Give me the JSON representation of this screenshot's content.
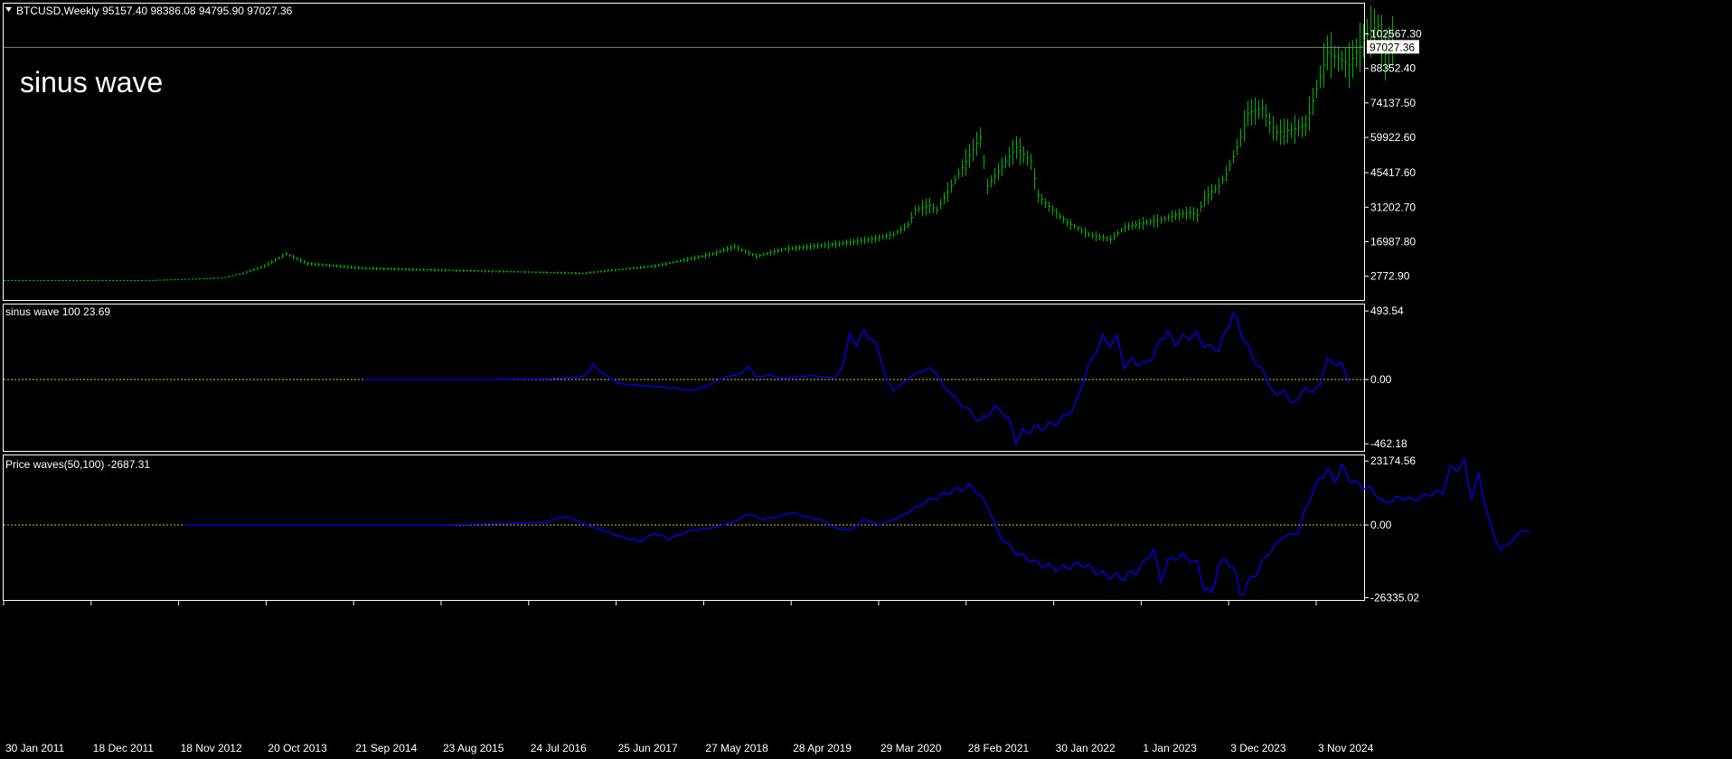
{
  "colors": {
    "background": "#000000",
    "frame": "#ffffff",
    "price_bars": "#00b000",
    "indicator_line": "#0000ff",
    "zero_line": "#d8c23a"
  },
  "main_panel": {
    "collapse_icon": "triangle-down-icon",
    "header": "BTCUSD,Weekly  95157.40 98386.08 94795.90 97027.36",
    "overlay_text": "sinus wave",
    "current_price": "97027.36"
  },
  "panel2": {
    "header": "sinus wave 100 23.69"
  },
  "panel3": {
    "header": "Price waves(50,100) -2687.31"
  },
  "chart_data": [
    {
      "type": "bar",
      "title": "BTCUSD,Weekly",
      "symbol": "BTCUSD",
      "timeframe": "Weekly",
      "ohlc_last": {
        "open": 95157.4,
        "high": 98386.08,
        "low": 94795.9,
        "close": 97027.36
      },
      "ylim": [
        -7000,
        115000
      ],
      "yticks": [
        "102567.30",
        "88352.40",
        "74137.50",
        "59922.60",
        "45417.60",
        "31202.70",
        "16987.80",
        "2772.90"
      ],
      "ytick_values": [
        102567.3,
        88352.4,
        74137.5,
        59922.6,
        45417.6,
        31202.7,
        16987.8,
        2772.9
      ],
      "xticks": [
        "30 Jan 2011",
        "18 Dec 2011",
        "18 Nov 2012",
        "20 Oct 2013",
        "21 Sep 2014",
        "23 Aug 2015",
        "24 Jul 2016",
        "25 Jun 2017",
        "27 May 2018",
        "28 Apr 2019",
        "29 Mar 2020",
        "28 Feb 2021",
        "30 Jan 2022",
        "1 Jan 2023",
        "3 Dec 2023",
        "3 Nov 2024"
      ],
      "series": [
        {
          "close_points": [
            [
              0,
              1
            ],
            [
              40,
              1
            ],
            [
              60,
              2
            ],
            [
              66,
              4
            ],
            [
              72,
              7
            ],
            [
              78,
              12
            ],
            [
              84,
              8
            ],
            [
              100,
              6
            ],
            [
              130,
              5
            ],
            [
              160,
              4
            ],
            [
              180,
              7
            ],
            [
              190,
              10
            ],
            [
              196,
              12
            ],
            [
              202,
              15
            ],
            [
              208,
              11
            ],
            [
              216,
              14
            ],
            [
              230,
              16
            ],
            [
              240,
              18
            ],
            [
              246,
              20
            ],
            [
              250,
              24
            ],
            [
              252,
              30
            ],
            [
              256,
              32
            ],
            [
              258,
              30
            ],
            [
              262,
              40
            ],
            [
              266,
              50
            ],
            [
              270,
              60
            ],
            [
              272,
              40
            ],
            [
              276,
              48
            ],
            [
              280,
              56
            ],
            [
              284,
              50
            ],
            [
              286,
              36
            ],
            [
              290,
              30
            ],
            [
              294,
              25
            ],
            [
              300,
              20
            ],
            [
              306,
              18
            ],
            [
              310,
              23
            ],
            [
              316,
              25
            ],
            [
              320,
              26
            ],
            [
              324,
              28
            ],
            [
              328,
              29
            ],
            [
              330,
              28
            ],
            [
              332,
              35
            ],
            [
              336,
              40
            ],
            [
              338,
              45
            ],
            [
              340,
              52
            ],
            [
              342,
              60
            ],
            [
              344,
              70
            ],
            [
              348,
              72
            ],
            [
              350,
              66
            ],
            [
              352,
              62
            ],
            [
              356,
              63
            ],
            [
              360,
              65
            ],
            [
              366,
              95
            ],
            [
              372,
              90
            ],
            [
              376,
              100
            ],
            [
              378,
              104
            ],
            [
              380,
              106
            ],
            [
              382,
              94
            ],
            [
              384,
              100
            ]
          ]
        }
      ]
    },
    {
      "type": "line",
      "title": "sinus wave 100 23.69",
      "name": "sinus wave",
      "period": 100,
      "last_value": 23.69,
      "ylim": [
        -520,
        540
      ],
      "yticks": [
        "493.54",
        "0.00",
        "-462.18"
      ],
      "ytick_values": [
        493.54,
        0,
        -462.18
      ],
      "zero_line": 0,
      "series": [
        {
          "points": [
            [
              100,
              0
            ],
            [
              130,
              0
            ],
            [
              140,
              2
            ],
            [
              150,
              5
            ],
            [
              155,
              10
            ],
            [
              160,
              20
            ],
            [
              162,
              60
            ],
            [
              163,
              110
            ],
            [
              164,
              80
            ],
            [
              166,
              40
            ],
            [
              170,
              -30
            ],
            [
              175,
              -40
            ],
            [
              180,
              -50
            ],
            [
              185,
              -60
            ],
            [
              188,
              -70
            ],
            [
              190,
              -80
            ],
            [
              194,
              -50
            ],
            [
              200,
              20
            ],
            [
              204,
              40
            ],
            [
              206,
              100
            ],
            [
              208,
              20
            ],
            [
              212,
              30
            ],
            [
              215,
              10
            ],
            [
              220,
              20
            ],
            [
              224,
              30
            ],
            [
              226,
              20
            ],
            [
              230,
              10
            ],
            [
              232,
              100
            ],
            [
              234,
              310
            ],
            [
              236,
              260
            ],
            [
              238,
              340
            ],
            [
              240,
              300
            ],
            [
              242,
              200
            ],
            [
              244,
              20
            ],
            [
              246,
              -80
            ],
            [
              248,
              -40
            ],
            [
              252,
              40
            ],
            [
              256,
              80
            ],
            [
              258,
              50
            ],
            [
              260,
              -50
            ],
            [
              262,
              -100
            ],
            [
              264,
              -160
            ],
            [
              266,
              -200
            ],
            [
              268,
              -250
            ],
            [
              270,
              -300
            ],
            [
              272,
              -260
            ],
            [
              274,
              -200
            ],
            [
              276,
              -220
            ],
            [
              278,
              -300
            ],
            [
              280,
              -430
            ],
            [
              282,
              -380
            ],
            [
              284,
              -360
            ],
            [
              288,
              -340
            ],
            [
              292,
              -300
            ],
            [
              296,
              -200
            ],
            [
              298,
              -60
            ],
            [
              300,
              100
            ],
            [
              302,
              200
            ],
            [
              304,
              300
            ],
            [
              306,
              250
            ],
            [
              308,
              300
            ],
            [
              310,
              80
            ],
            [
              312,
              150
            ],
            [
              314,
              100
            ],
            [
              318,
              160
            ],
            [
              320,
              300
            ],
            [
              322,
              330
            ],
            [
              324,
              260
            ],
            [
              326,
              300
            ],
            [
              330,
              320
            ],
            [
              332,
              250
            ],
            [
              336,
              210
            ],
            [
              340,
              480
            ],
            [
              342,
              350
            ],
            [
              344,
              250
            ],
            [
              346,
              120
            ],
            [
              348,
              80
            ],
            [
              350,
              -40
            ],
            [
              352,
              -120
            ],
            [
              354,
              -70
            ],
            [
              356,
              -180
            ],
            [
              358,
              -130
            ],
            [
              360,
              -60
            ],
            [
              362,
              -90
            ],
            [
              364,
              -40
            ],
            [
              366,
              150
            ],
            [
              368,
              110
            ],
            [
              370,
              120
            ],
            [
              372,
              -20
            ]
          ]
        }
      ]
    },
    {
      "type": "line",
      "title": "Price waves(50,100) -2687.31",
      "name": "Price waves",
      "params": [
        50,
        100
      ],
      "last_value": -2687.31,
      "ylim": [
        -27500,
        25200
      ],
      "yticks": [
        "23174.56",
        "0.00",
        "-26335.02"
      ],
      "ytick_values": [
        23174.56,
        0,
        -26335.02
      ],
      "zero_line": 0,
      "series": [
        {
          "points": [
            [
              50,
              0
            ],
            [
              100,
              0
            ],
            [
              120,
              0
            ],
            [
              140,
              500
            ],
            [
              150,
              1000
            ],
            [
              155,
              3000
            ],
            [
              158,
              2000
            ],
            [
              162,
              -500
            ],
            [
              166,
              -2000
            ],
            [
              170,
              -4000
            ],
            [
              176,
              -6000
            ],
            [
              180,
              -3000
            ],
            [
              184,
              -5000
            ],
            [
              190,
              -2000
            ],
            [
              196,
              -1000
            ],
            [
              202,
              1000
            ],
            [
              206,
              4000
            ],
            [
              210,
              2000
            ],
            [
              214,
              3000
            ],
            [
              218,
              4500
            ],
            [
              222,
              3000
            ],
            [
              226,
              2000
            ],
            [
              230,
              -1000
            ],
            [
              234,
              -2000
            ],
            [
              238,
              2000
            ],
            [
              242,
              0
            ],
            [
              248,
              3000
            ],
            [
              256,
              9000
            ],
            [
              264,
              13000
            ],
            [
              268,
              14000
            ],
            [
              272,
              7000
            ],
            [
              276,
              -5000
            ],
            [
              280,
              -10000
            ],
            [
              286,
              -14000
            ],
            [
              292,
              -16000
            ],
            [
              298,
              -14000
            ],
            [
              304,
              -18000
            ],
            [
              310,
              -19000
            ],
            [
              314,
              -16000
            ],
            [
              318,
              -9000
            ],
            [
              320,
              -20000
            ],
            [
              322,
              -13000
            ],
            [
              326,
              -11000
            ],
            [
              330,
              -14000
            ],
            [
              332,
              -22000
            ],
            [
              334,
              -26000
            ],
            [
              336,
              -14000
            ],
            [
              338,
              -13000
            ],
            [
              340,
              -15000
            ],
            [
              342,
              -25000
            ],
            [
              346,
              -18000
            ],
            [
              350,
              -10000
            ],
            [
              354,
              -4000
            ],
            [
              358,
              -3000
            ],
            [
              360,
              6000
            ],
            [
              364,
              17000
            ],
            [
              366,
              20000
            ],
            [
              368,
              16000
            ],
            [
              370,
              21000
            ],
            [
              372,
              17000
            ],
            [
              374,
              15000
            ],
            [
              378,
              13000
            ],
            [
              382,
              8000
            ],
            [
              386,
              10000
            ],
            [
              390,
              9000
            ],
            [
              394,
              11000
            ],
            [
              398,
              12000
            ],
            [
              400,
              20000
            ],
            [
              404,
              22000
            ],
            [
              406,
              10000
            ],
            [
              408,
              18000
            ],
            [
              410,
              6000
            ],
            [
              412,
              -3000
            ],
            [
              414,
              -9000
            ],
            [
              416,
              -7000
            ],
            [
              420,
              -2000
            ],
            [
              422,
              -2500
            ]
          ]
        }
      ]
    }
  ]
}
